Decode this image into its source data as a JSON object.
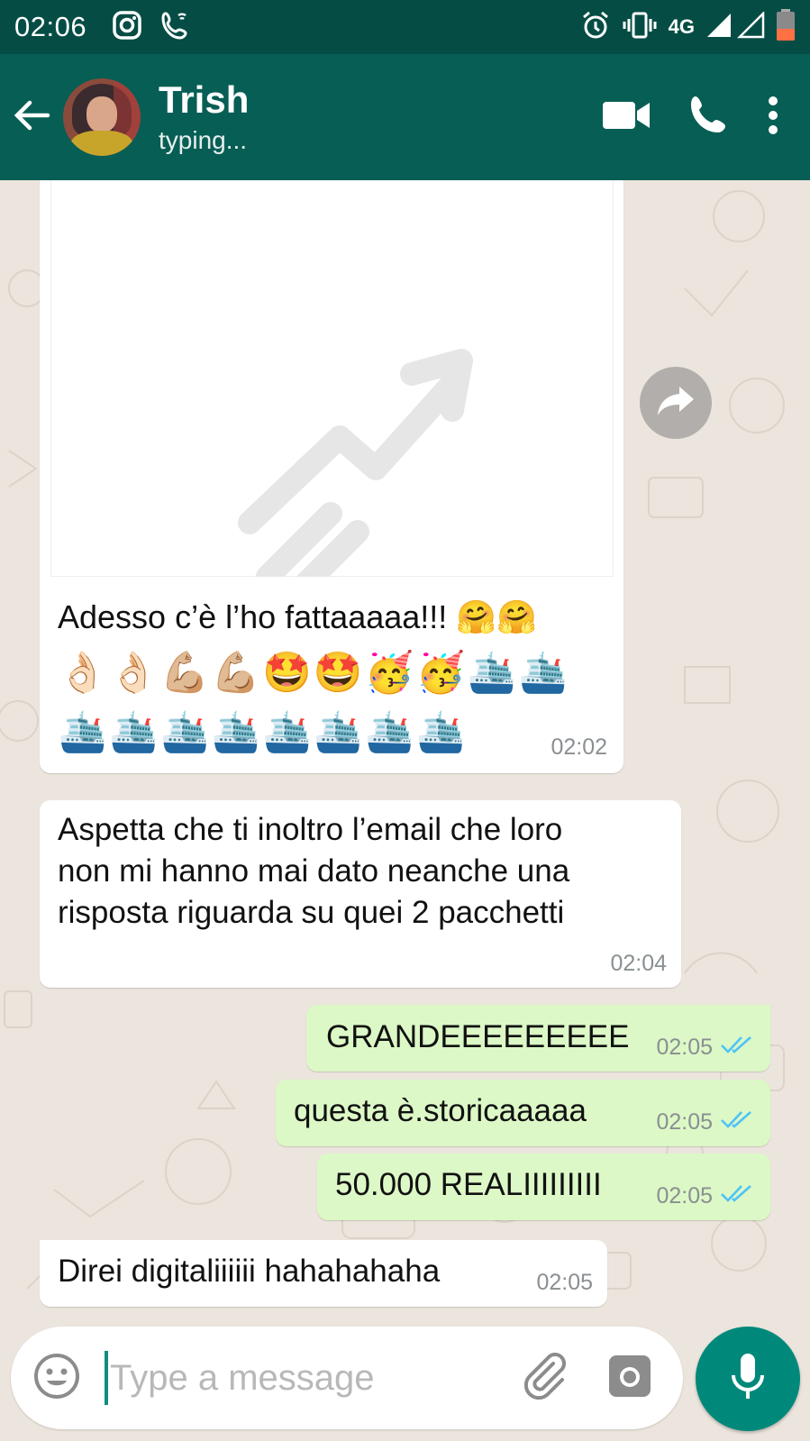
{
  "status_bar": {
    "time": "02:06",
    "network": "4G",
    "icons": [
      "instagram-icon",
      "wifi-call-icon",
      "alarm-icon",
      "vibrate-icon",
      "signal-icon",
      "battery-icon"
    ]
  },
  "header": {
    "contact_name": "Trish",
    "contact_status": "typing...",
    "icons": [
      "back-arrow-icon",
      "video-call-icon",
      "voice-call-icon",
      "more-options-icon"
    ]
  },
  "messages": [
    {
      "direction": "incoming",
      "type": "link-preview",
      "text": "Adesso c’è l’ho fattaaaaa!!! 🤗🤗",
      "emoji_line_1": "👌🏻👌🏻💪🏼💪🏼🤩🤩🥳🥳🛳️🛳️",
      "emoji_line_2": "🛳️🛳️🛳️🛳️🛳️🛳️🛳️🛳️",
      "time": "02:02"
    },
    {
      "direction": "incoming",
      "text_lines": [
        "Aspetta che ti inoltro l’email che loro",
        "non mi hanno mai dato neanche una",
        "risposta riguarda su quei 2 pacchetti"
      ],
      "time": "02:04"
    },
    {
      "direction": "outgoing",
      "text": "GRANDEEEEEEEEE",
      "time": "02:05",
      "read": true
    },
    {
      "direction": "outgoing",
      "text": "questa è.storicaaaaa",
      "time": "02:05",
      "read": true
    },
    {
      "direction": "outgoing",
      "text": "50.000 REALIIIIIIIII",
      "time": "02:05",
      "read": true
    },
    {
      "direction": "incoming",
      "text": "Direi digitaliiiiii hahahahaha",
      "time": "02:05"
    }
  ],
  "composer": {
    "placeholder": "Type a message",
    "icons": [
      "emoji-icon",
      "attach-icon",
      "camera-icon",
      "mic-icon"
    ]
  },
  "colors": {
    "header": "#075e54",
    "status_bar": "#054d44",
    "outgoing_bubble": "#dcf8c6",
    "incoming_bubble": "#ffffff",
    "read_ticks": "#4fc3f7",
    "mic_button": "#00897b"
  }
}
